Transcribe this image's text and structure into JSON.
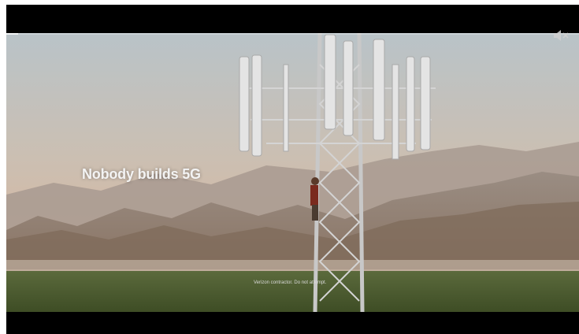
{
  "player": {
    "caption_headline": "Nobody builds 5G",
    "disclaimer": "Verizon contractor. Do not attempt.",
    "progress": 0.02,
    "muted": true
  },
  "icons": {
    "mute": "speaker-muted-icon"
  },
  "colors": {
    "sky_top": "#bfc6c9",
    "sky_bottom": "#d6b7a1",
    "mountain": "#8f7f73",
    "field": "#4a5a2e",
    "tower": "#c9c9c9"
  }
}
